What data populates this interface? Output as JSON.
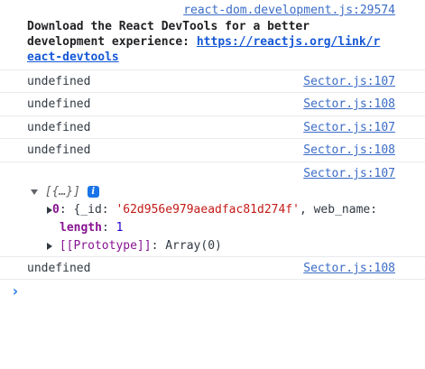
{
  "devtools": {
    "source": "react-dom.development.js:29574",
    "message_line1": "Download the React DevTools for a better",
    "message_line2": "development experience: ",
    "link_part1": "https://reactjs.org/link/r",
    "link_part2": "eact-devtools"
  },
  "logs": [
    {
      "text": "undefined",
      "source": "Sector.js:107"
    },
    {
      "text": "undefined",
      "source": "Sector.js:108"
    },
    {
      "text": "undefined",
      "source": "Sector.js:107"
    },
    {
      "text": "undefined",
      "source": "Sector.js:108"
    }
  ],
  "array_log": {
    "source": "Sector.js:107",
    "summary": "[{…}]",
    "info_badge": "i",
    "item0_index": "0",
    "item0_preview_open": ": {_id: ",
    "item0_id": "'62d956e979aeadfac81d274f'",
    "item0_rest": ", web_name:",
    "length_key": "length",
    "length_sep": ": ",
    "length_value": "1",
    "proto_key": "[[Prototype]]",
    "proto_value": ": Array(0)"
  },
  "last_log": {
    "text": "undefined",
    "source": "Sector.js:108"
  },
  "prompt_symbol": "›",
  "icons": {
    "expand_arrow": "chevron-right-icon",
    "collapse_arrow": "chevron-down-icon",
    "info": "info-icon"
  }
}
